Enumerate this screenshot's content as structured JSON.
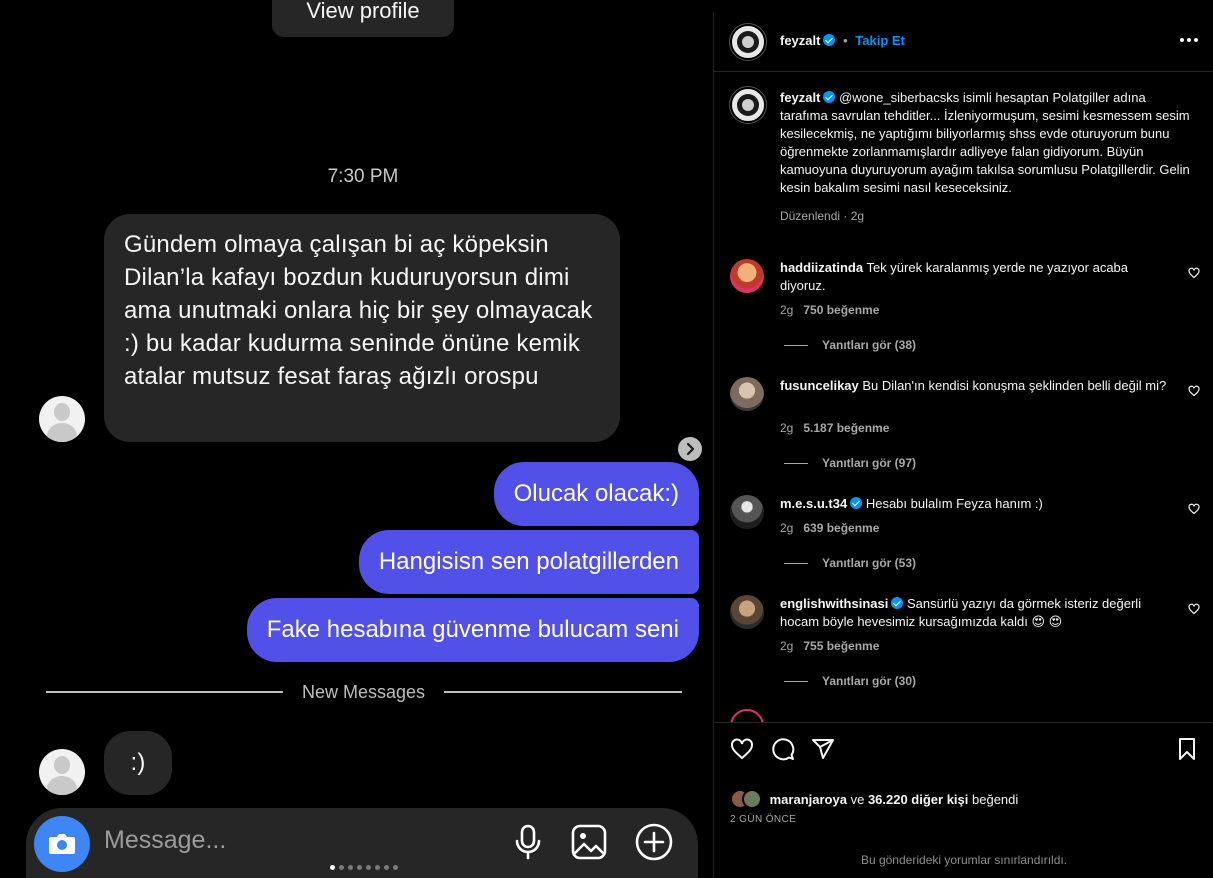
{
  "dm": {
    "view_profile": "View profile",
    "timestamp": "7:30 PM",
    "incoming_1": "Gündem olmaya çalışan bi aç köpeksin Dilan’la kafayı bozdun kuduruyorsun dimi ama unutmaki onlara hiç bir şey olmayacak :) bu kadar kudurma seninde önüne kemik atalar mutsuz fesat faraş ağızlı orospu",
    "outgoing": [
      "Olucak olacak:)",
      "Hangisisn sen polatgillerden",
      "Fake hesabına güvenme bulucam seni"
    ],
    "new_messages": "New Messages",
    "incoming_2": ":)",
    "composer_placeholder": "Message...",
    "accent_color": "#5151e9",
    "camera_color": "#3e86f5"
  },
  "post": {
    "header": {
      "username": "feyzalt",
      "separator": "•",
      "follow": "Takip Et"
    },
    "caption": {
      "username": "feyzalt",
      "text": "@wone_siberbacsks isimli hesaptan Polatgiller adına tarafıma savrulan tehditler... İzleniyormuşum, sesimi kesmessem sesim kesilecekmiş, ne yaptığımı biliyorlarmış shss evde oturuyorum bunu öğrenmekte zorlanmamışlardır adliyeye falan gidiyorum. Büyün kamuoyuna duyuruyorum ayağım takılsa sorumlusu Polatgillerdir. Gelin kesin bakalım sesimi nasıl keseceksiniz.",
      "meta": "Düzenlendi · 2g"
    },
    "comments": [
      {
        "username": "haddiizatinda",
        "verified": false,
        "text": "Tek yürek karalanmış yerde ne yazıyor acaba diyoruz.",
        "age": "2g",
        "likes": "750 beğenme",
        "replies": "Yanıtları gör (38)"
      },
      {
        "username": "fusuncelikay",
        "verified": false,
        "text": "Bu Dilan'ın kendisi konuşma şeklinden belli değil mi?",
        "age": "2g",
        "likes": "5.187 beğenme",
        "replies": "Yanıtları gör (97)"
      },
      {
        "username": "m.e.s.u.t34",
        "verified": true,
        "text": "Hesabı bulalım Feyza hanım :)",
        "age": "2g",
        "likes": "639 beğenme",
        "replies": "Yanıtları gör (53)"
      },
      {
        "username": "englishwithsinasi",
        "verified": true,
        "text": "Sansürlü yazıyı da görmek isteriz değerli hocam böyle hevesimiz kursağımızda kaldı 😍 😍",
        "age": "2g",
        "likes": "755 beğenme",
        "replies": "Yanıtları gör (30)"
      }
    ],
    "likes": {
      "user": "maranjaroya",
      "connector": "ve",
      "others": "36.220 diğer kişi",
      "suffix": "beğendi"
    },
    "date": "2 GÜN ÖNCE",
    "restricted": "Bu gönderideki yorumlar sınırlandırıldı.",
    "link_color": "#0095f6"
  }
}
